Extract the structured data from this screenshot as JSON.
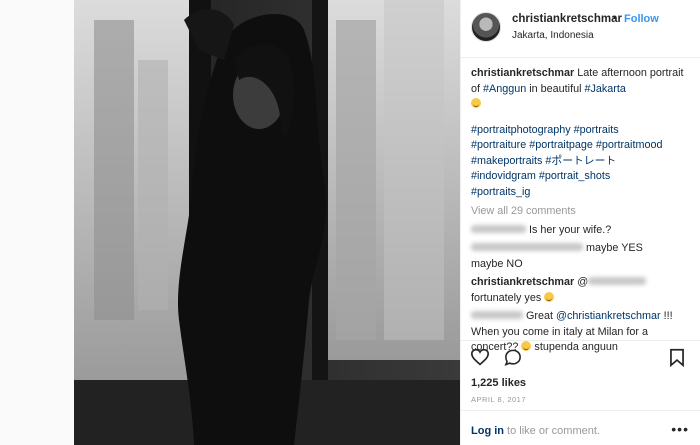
{
  "post": {
    "username": "christiankretschmar",
    "follow_dot": "•",
    "follow": "Follow",
    "location": "Jakarta, Indonesia"
  },
  "caption": {
    "username": "christiankretschmar",
    "text1": " Late afternoon portrait of ",
    "tag_anggun": "#Anggun",
    "text2": " in beautiful ",
    "tag_jakarta": "#Jakarta",
    "hashtags_line1": "#portraitphotography #portraits",
    "hashtags_line2": "#portraiture #portraitpage #portraitmood",
    "hashtags_line3": "#makeportraits #ポートレート",
    "hashtags_line4": "#indovidgram #portrait_shots",
    "hashtags_line5": "#portraits_ig"
  },
  "comments": {
    "view_all": "View all 29 comments",
    "c1_text": "Is her your wife.?",
    "c2_text": "maybe YES",
    "c2_text2": "maybe NO",
    "c3_user": "christiankretschmar",
    "c3_at": "@",
    "c3_text": "fortunately yes",
    "c4_text1": "Great ",
    "c4_mention": "@christiankretschmar",
    "c4_text2": " !!! When you come in italy at Milan for a concert?? ",
    "c4_text3": " stupenda anguun"
  },
  "stats": {
    "likes": "1,225 likes",
    "date": "APRIL 8, 2017"
  },
  "footer": {
    "login": "Log in",
    "rest": " to like or comment.",
    "more": "•••"
  },
  "icons": {
    "like": "heart-icon",
    "comment": "comment-bubble-icon",
    "save": "bookmark-icon"
  }
}
